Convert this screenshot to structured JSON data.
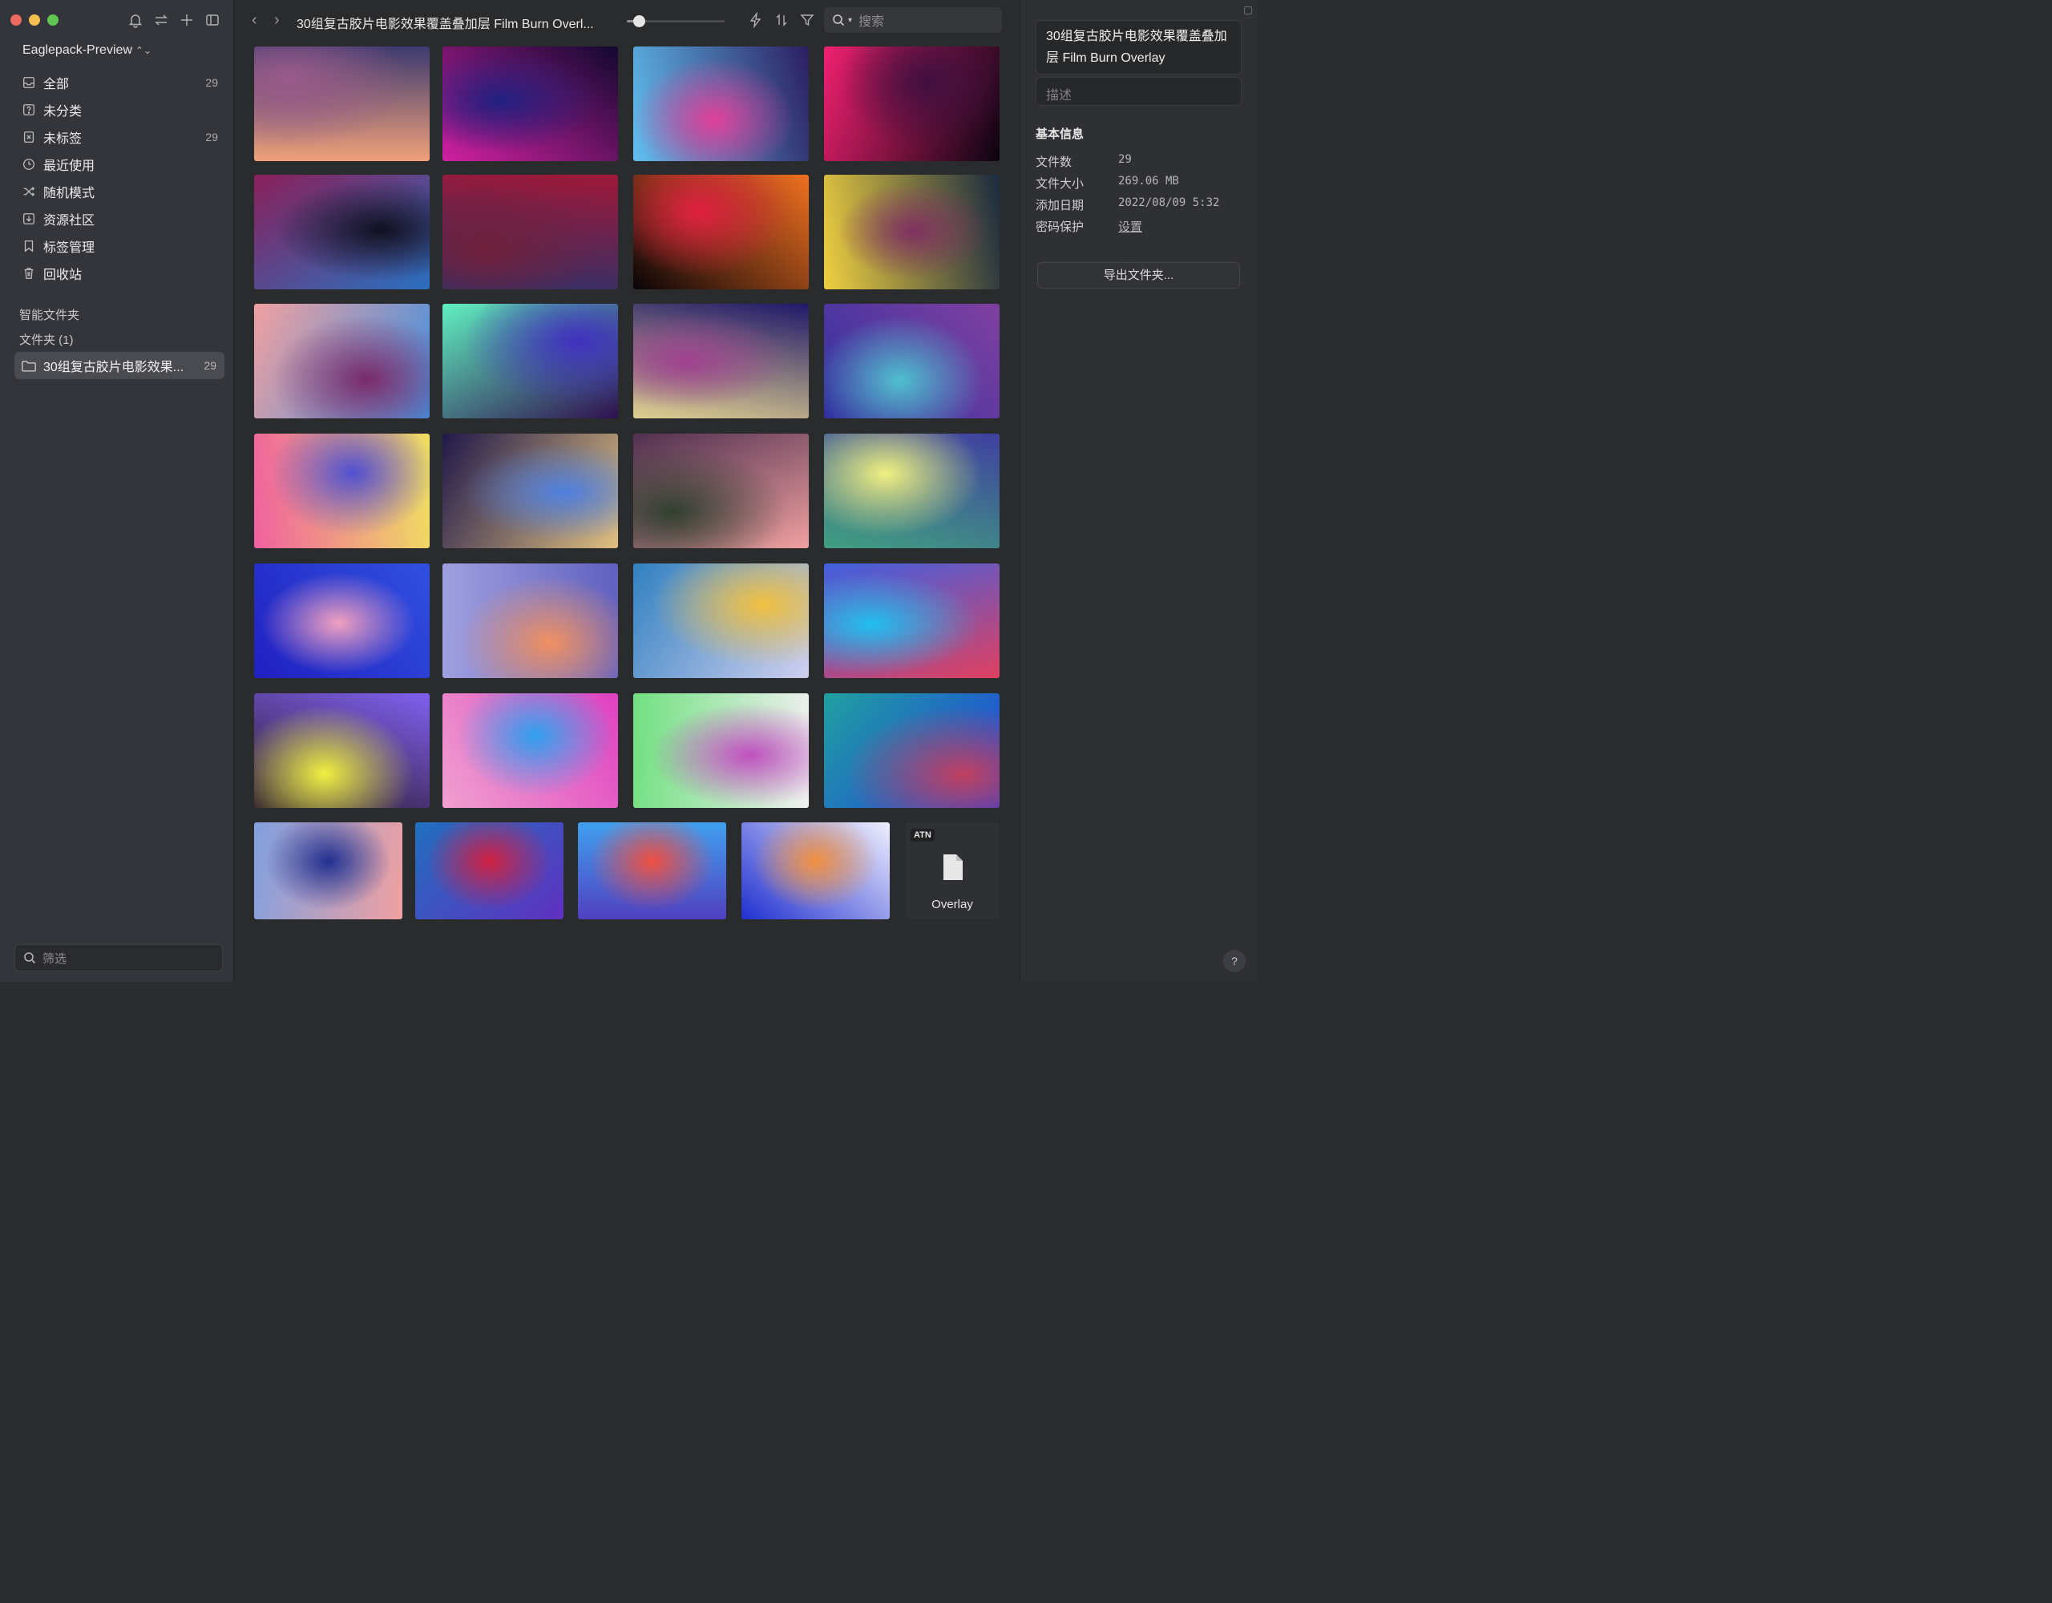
{
  "sidebar": {
    "library_name": "Eaglepack-Preview",
    "nav": [
      {
        "label": "全部",
        "count": "29",
        "icon": "inbox-icon"
      },
      {
        "label": "未分类",
        "count": "",
        "icon": "question-box-icon"
      },
      {
        "label": "未标签",
        "count": "29",
        "icon": "untagged-icon"
      },
      {
        "label": "最近使用",
        "count": "",
        "icon": "clock-icon"
      },
      {
        "label": "随机模式",
        "count": "",
        "icon": "shuffle-icon"
      },
      {
        "label": "资源社区",
        "count": "",
        "icon": "download-box-icon"
      },
      {
        "label": "标签管理",
        "count": "",
        "icon": "bookmark-icon"
      },
      {
        "label": "回收站",
        "count": "",
        "icon": "trash-icon"
      }
    ],
    "smart_folders_label": "智能文件夹",
    "folders_label": "文件夹 (1)",
    "folder": {
      "label": "30组复古胶片电影效果...",
      "count": "29"
    },
    "filter_placeholder": "筛选"
  },
  "toolbar": {
    "title": "30组复古胶片电影效果覆盖叠加层 Film Burn Overl...",
    "zoom_fraction": 0.12,
    "search_placeholder": "搜索"
  },
  "grid": {
    "thumbnail_gradients": [
      [
        "#f0a07a",
        "#9a5a8a",
        "#3c3a70"
      ],
      [
        "#d020a0",
        "#202080",
        "#120830"
      ],
      [
        "#60c0f0",
        "#e0409a",
        "#2c1e60"
      ],
      [
        "#f02070",
        "#401040",
        "#0a0410"
      ],
      [
        "#8a1f5a",
        "#101020",
        "#2a70c0"
      ],
      [
        "#a01838",
        "#70203a",
        "#303068"
      ],
      [
        "#f07020",
        "#e02040",
        "#0a0408"
      ],
      [
        "#1a2a40",
        "#803060",
        "#f0d040"
      ],
      [
        "#4090e0",
        "#7a2a6a",
        "#f0a0a0"
      ],
      [
        "#301050",
        "#4030c0",
        "#60f0c0"
      ],
      [
        "#e0d090",
        "#a04090",
        "#20186a"
      ],
      [
        "#3030a0",
        "#50c0d0",
        "#8040a0"
      ],
      [
        "#f060a0",
        "#5050d0",
        "#f0e060"
      ],
      [
        "#20184a",
        "#5080e0",
        "#e0c080"
      ],
      [
        "#503050",
        "#304030",
        "#f0a0a0"
      ],
      [
        "#4040a0",
        "#f0f080",
        "#40a080"
      ],
      [
        "#3050e0",
        "#f0a0c0",
        "#2020c0"
      ],
      [
        "#6060c0",
        "#f09060",
        "#a0a0e0"
      ],
      [
        "#d0d0f0",
        "#f0c040",
        "#3080c0"
      ],
      [
        "#e04060",
        "#20c0f0",
        "#4060e0"
      ],
      [
        "#2a1a2a",
        "#f0f040",
        "#8060f0"
      ],
      [
        "#f0a0d0",
        "#30a0f0",
        "#e040c0"
      ],
      [
        "#70e080",
        "#c050c0",
        "#f0f0f0"
      ],
      [
        "#20a0a0",
        "#c04060",
        "#2040e0"
      ],
      [
        "#80a0e0",
        "#203090",
        "#f0a0a0"
      ],
      [
        "#2070c0",
        "#d02040",
        "#6030c0"
      ],
      [
        "#40a0f0",
        "#f05040",
        "#5040c0"
      ],
      [
        "#f0f0ff",
        "#f09040",
        "#2030d0"
      ]
    ],
    "atn_file": {
      "badge": "ATN",
      "name": "Overlay",
      "icon": "file-icon"
    }
  },
  "inspector": {
    "title": "30组复古胶片电影效果覆盖叠加层 Film Burn Overlay",
    "description_placeholder": "描述",
    "section_title": "基本信息",
    "info": [
      {
        "key": "文件数",
        "value": "29"
      },
      {
        "key": "文件大小",
        "value": "269.06 MB"
      },
      {
        "key": "添加日期",
        "value": "2022/08/09 5:32"
      },
      {
        "key": "密码保护",
        "value": "设置"
      }
    ],
    "export_label": "导出文件夹...",
    "help_label": "?"
  }
}
